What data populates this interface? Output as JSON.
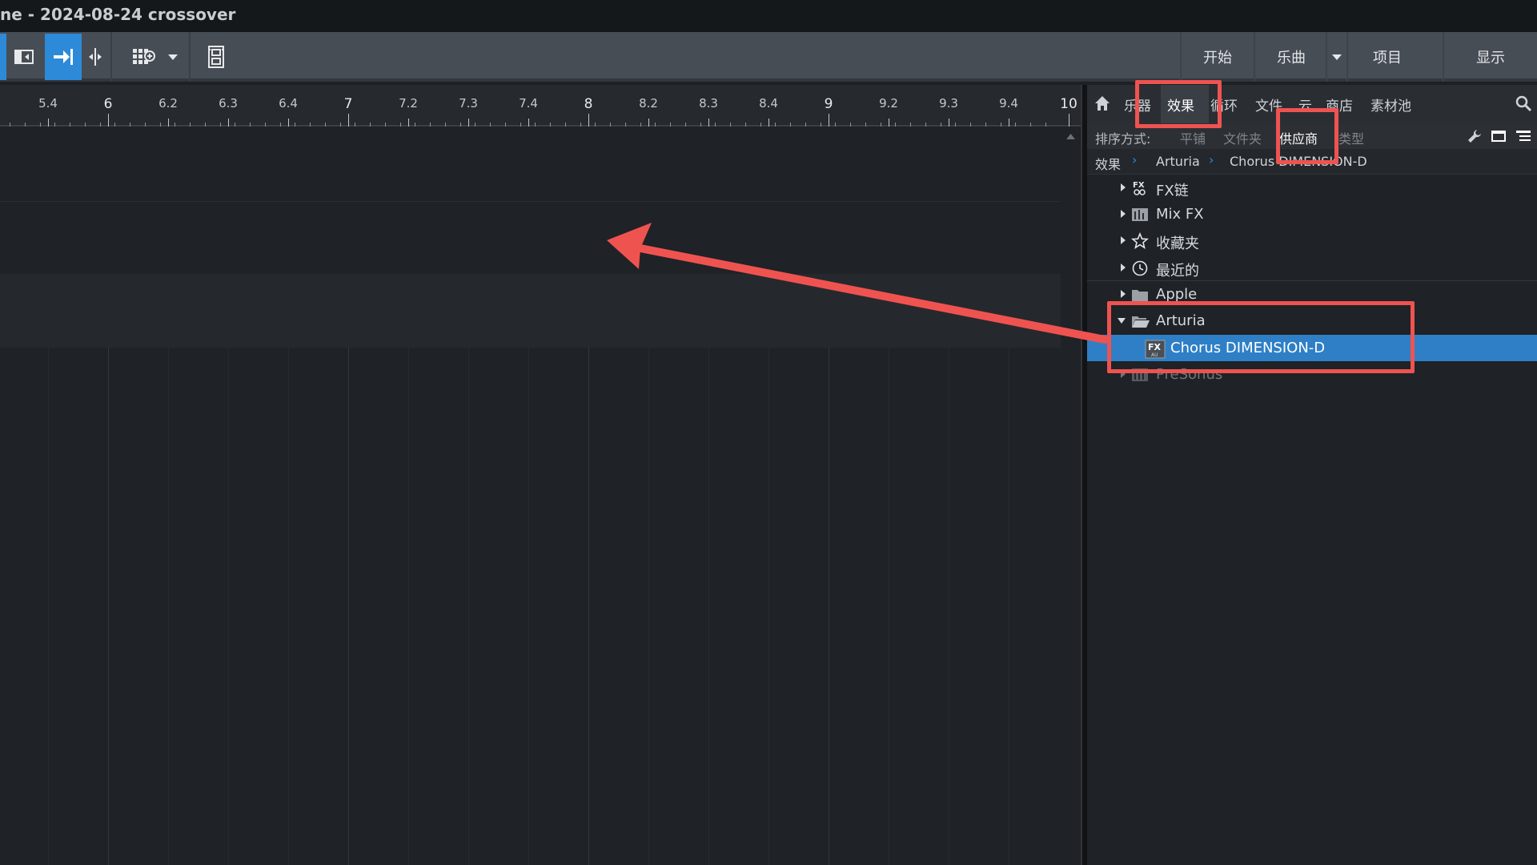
{
  "window": {
    "title": "ne - 2024-08-24 crossover"
  },
  "toolbar": {
    "menus": [
      "开始",
      "乐曲",
      "项目",
      "显示"
    ]
  },
  "ruler": {
    "labels": [
      {
        "text": "5.4",
        "major": false
      },
      {
        "text": "6",
        "major": true
      },
      {
        "text": "6.2",
        "major": false
      },
      {
        "text": "6.3",
        "major": false
      },
      {
        "text": "6.4",
        "major": false
      },
      {
        "text": "7",
        "major": true
      },
      {
        "text": "7.2",
        "major": false
      },
      {
        "text": "7.3",
        "major": false
      },
      {
        "text": "7.4",
        "major": false
      },
      {
        "text": "8",
        "major": true
      },
      {
        "text": "8.2",
        "major": false
      },
      {
        "text": "8.3",
        "major": false
      },
      {
        "text": "8.4",
        "major": false
      },
      {
        "text": "9",
        "major": true
      },
      {
        "text": "9.2",
        "major": false
      },
      {
        "text": "9.3",
        "major": false
      },
      {
        "text": "9.4",
        "major": false
      },
      {
        "text": "10",
        "major": true
      }
    ]
  },
  "browser": {
    "tabs": [
      "乐器",
      "效果",
      "循环",
      "文件",
      "云",
      "商店",
      "素材池"
    ],
    "active_tab": "效果",
    "sort": {
      "label": "排序方式:",
      "options": [
        "平铺",
        "文件夹",
        "供应商",
        "类型"
      ],
      "active": "供应商"
    },
    "breadcrumb": [
      "效果",
      "Arturia",
      "Chorus DIMENSION-D"
    ],
    "tree": [
      {
        "label": "FX链",
        "icon": "fx-chain-icon",
        "expanded": false
      },
      {
        "label": "Mix FX",
        "icon": "mix-fx-icon",
        "expanded": false
      },
      {
        "label": "收藏夹",
        "icon": "star-icon",
        "expanded": false
      },
      {
        "label": "最近的",
        "icon": "clock-icon",
        "expanded": false
      },
      {
        "label": "Apple",
        "icon": "folder-icon",
        "expanded": false
      },
      {
        "label": "Arturia",
        "icon": "folder-open-icon",
        "expanded": true
      },
      {
        "label": "Chorus DIMENSION-D",
        "icon": "fx-plugin-icon",
        "child": true,
        "selected": true
      },
      {
        "label": "PreSonus",
        "icon": "mix-fx-icon",
        "expanded": false
      }
    ]
  },
  "colors": {
    "accent": "#2c8ad8",
    "selection": "#2e7fc6",
    "annotation": "#ef5350",
    "background": "#1f2226",
    "toolbar": "#474d55"
  }
}
